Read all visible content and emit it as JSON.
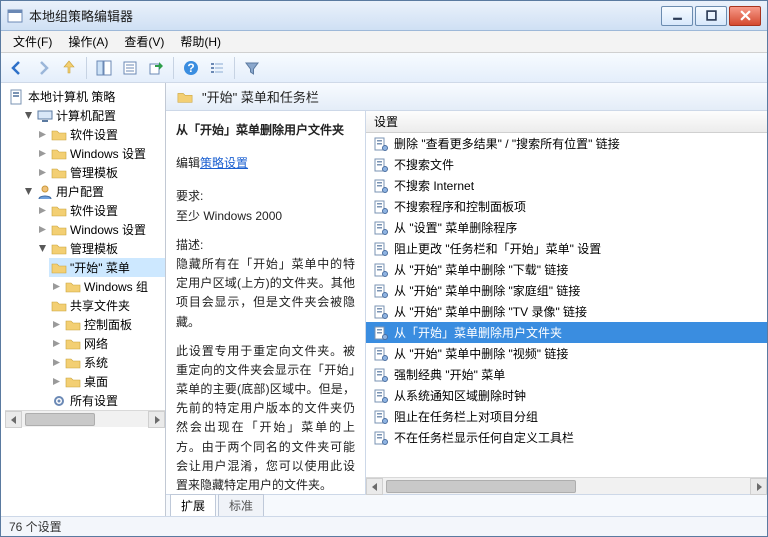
{
  "window": {
    "title": "本地组策略编辑器"
  },
  "menubar": {
    "items": [
      "文件(F)",
      "操作(A)",
      "查看(V)",
      "帮助(H)"
    ]
  },
  "toolbar": {
    "icons": [
      "back-icon",
      "forward-icon",
      "up-icon",
      "show-tree-icon",
      "properties-icon",
      "export-icon",
      "help-icon",
      "list-icon",
      "filter-icon"
    ]
  },
  "tree": {
    "root": {
      "label": "本地计算机 策略"
    },
    "computer": {
      "label": "计算机配置",
      "children": [
        "软件设置",
        "Windows 设置",
        "管理模板"
      ]
    },
    "user": {
      "label": "用户配置",
      "soft": "软件设置",
      "winset": "Windows 设置",
      "admin": {
        "label": "管理模板",
        "children": [
          "\"开始\" 菜单",
          "Windows 组",
          "共享文件夹",
          "控制面板",
          "网络",
          "系统",
          "桌面"
        ],
        "all": "所有设置"
      }
    }
  },
  "header": {
    "title": "\"开始\" 菜单和任务栏"
  },
  "desc": {
    "heading": "从「开始」菜单删除用户文件夹",
    "editPrefix": "编辑",
    "editLink": "策略设置",
    "reqLabel": "要求:",
    "reqText": "至少 Windows 2000",
    "descLabel": "描述:",
    "p1": "隐藏所有在「开始」菜单中的特定用户区域(上方)的文件夹。其他项目会显示，但是文件夹会被隐藏。",
    "p2": "此设置专用于重定向文件夹。被重定向的文件夹会显示在「开始」菜单的主要(底部)区域中。但是，先前的特定用户版本的文件夹仍然会出现在「开始」菜单的上方。由于两个同名的文件夹可能会让用户混淆，您可以使用此设置来隐藏特定用户的文件夹。"
  },
  "list": {
    "header": "设置",
    "items": [
      "删除 \"查看更多结果\" / \"搜索所有位置\" 链接",
      "不搜索文件",
      "不搜索 Internet",
      "不搜索程序和控制面板项",
      "从 \"设置\" 菜单删除程序",
      "阻止更改 \"任务栏和「开始」菜单\" 设置",
      "从 \"开始\" 菜单中删除 \"下载\" 链接",
      "从 \"开始\" 菜单中删除 \"家庭组\" 链接",
      "从 \"开始\" 菜单中删除 \"TV 录像\" 链接",
      "从「开始」菜单删除用户文件夹",
      "从 \"开始\" 菜单中删除 \"视频\" 链接",
      "强制经典 \"开始\" 菜单",
      "从系统通知区域删除时钟",
      "阻止在任务栏上对项目分组",
      "不在任务栏显示任何自定义工具栏"
    ],
    "selectedIndex": 9
  },
  "tabs": {
    "items": [
      "扩展",
      "标准"
    ],
    "active": 0
  },
  "status": {
    "text": "76 个设置"
  }
}
